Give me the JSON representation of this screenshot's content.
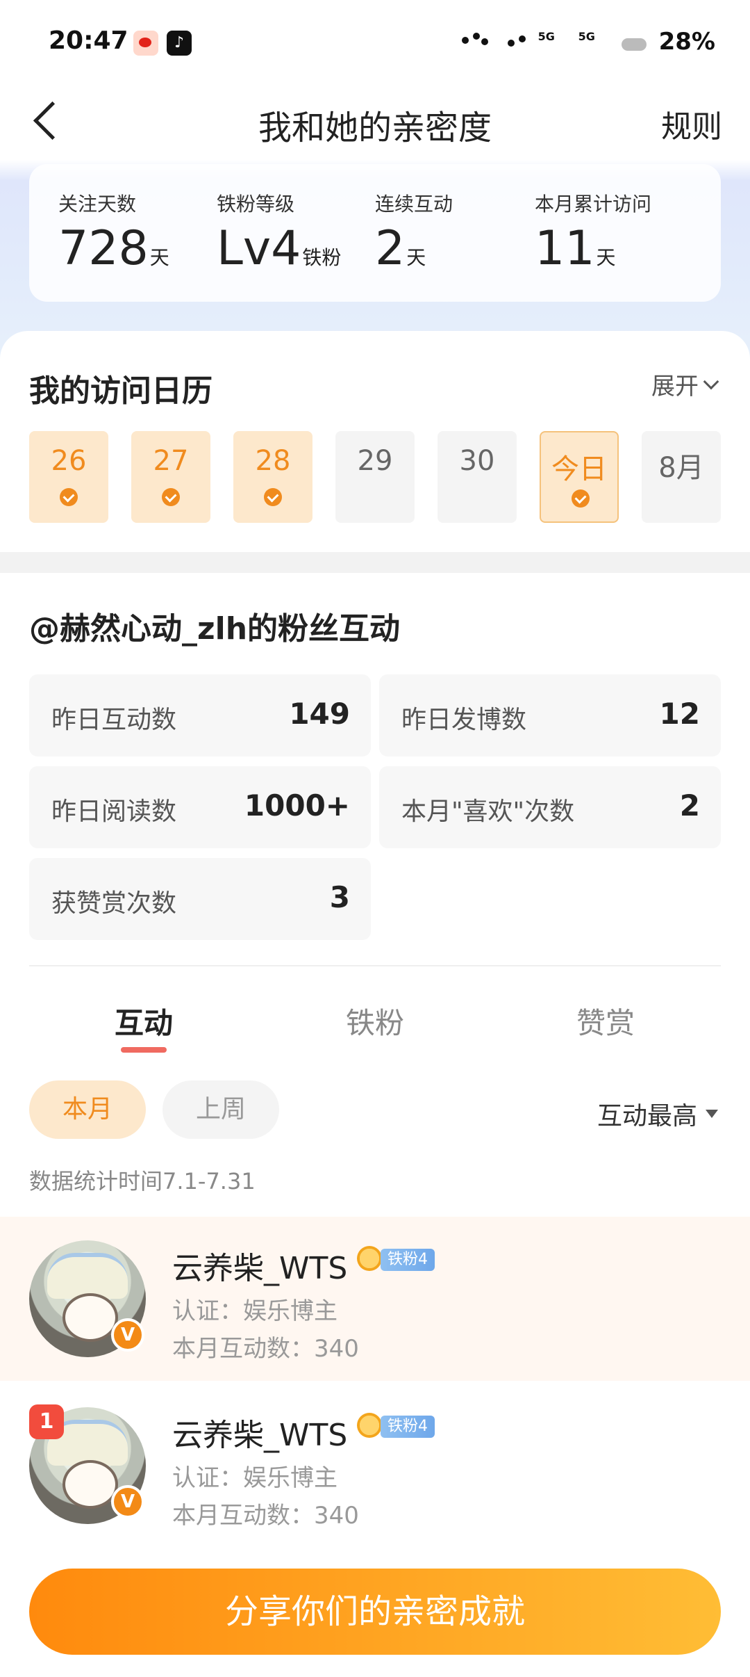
{
  "status_bar": {
    "time": "20:47",
    "signal_label_1": "5G",
    "signal_label_2": "5G",
    "battery": "28%",
    "app_icons": [
      "weibo-icon",
      "tiktok-icon"
    ]
  },
  "header": {
    "title": "我和她的亲密度",
    "rules_label": "规则"
  },
  "stats": [
    {
      "label": "关注天数",
      "value": "728",
      "unit": "天"
    },
    {
      "label": "铁粉等级",
      "value": "Lv4",
      "unit": "铁粉"
    },
    {
      "label": "连续互动",
      "value": "2",
      "unit": "天"
    },
    {
      "label": "本月累计访问",
      "value": "11",
      "unit": "天"
    }
  ],
  "calendar": {
    "title": "我的访问日历",
    "expand_label": "展开",
    "days": [
      {
        "label": "26",
        "state": "visited"
      },
      {
        "label": "27",
        "state": "visited"
      },
      {
        "label": "28",
        "state": "visited"
      },
      {
        "label": "29",
        "state": "none"
      },
      {
        "label": "30",
        "state": "none"
      },
      {
        "label": "今日",
        "state": "today"
      },
      {
        "label": "8月",
        "state": "none"
      }
    ]
  },
  "fan_section": {
    "title": "@赫然心动_zlh的粉丝互动",
    "metrics": [
      {
        "label": "昨日互动数",
        "value": "149"
      },
      {
        "label": "昨日发博数",
        "value": "12"
      },
      {
        "label": "昨日阅读数",
        "value": "1000+"
      },
      {
        "label": "本月\"喜欢\"次数",
        "value": "2"
      },
      {
        "label": "获赞赏次数",
        "value": "3"
      }
    ]
  },
  "tabs": [
    {
      "label": "互动",
      "active": true
    },
    {
      "label": "铁粉",
      "active": false
    },
    {
      "label": "赞赏",
      "active": false
    }
  ],
  "filters": {
    "this_month": "本月",
    "last_week": "上周",
    "sort_label": "互动最高",
    "data_range": "数据统计时间7.1-7.31"
  },
  "users": [
    {
      "name": "云养柴_WTS",
      "badge": "铁粉4",
      "cert": "认证：娱乐博主",
      "count": "本月互动数：340",
      "rank": "",
      "verified": "V"
    },
    {
      "name": "云养柴_WTS",
      "badge": "铁粉4",
      "cert": "认证：娱乐博主",
      "count": "本月互动数：340",
      "rank": "1",
      "verified": "V"
    }
  ],
  "share_button": "分享你们的亲密成就",
  "colors": {
    "accent_orange": "#f08b1e",
    "active_tab_underline": "#f06a60",
    "share_gradient_start": "#ff8a0d",
    "share_gradient_end": "#ffbd35"
  }
}
